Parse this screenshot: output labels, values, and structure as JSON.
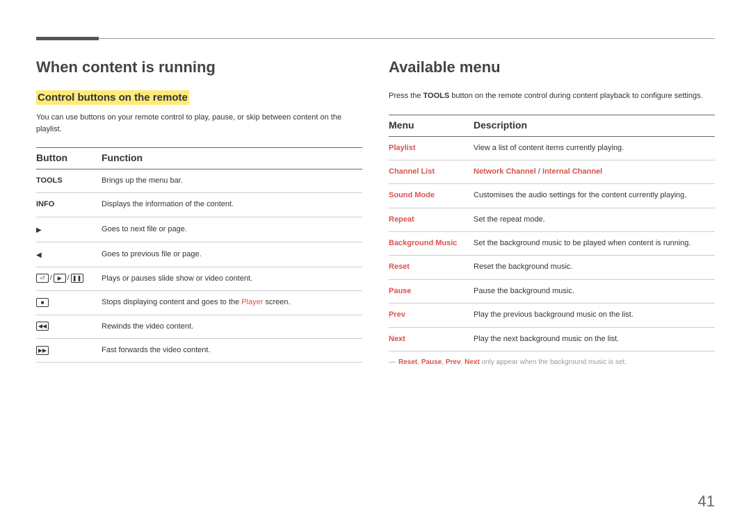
{
  "left": {
    "heading": "When content is running",
    "subheading": "Control buttons on the remote",
    "intro": "You can use buttons on your remote control to play, pause, or skip between content on the playlist.",
    "table": {
      "h1": "Button",
      "h2": "Function",
      "rows": [
        {
          "btn_type": "text",
          "btn": "TOOLS",
          "fn": "Brings up the menu bar."
        },
        {
          "btn_type": "text",
          "btn": "INFO",
          "fn": "Displays the information of the content."
        },
        {
          "btn_type": "arrow_right",
          "fn": "Goes to next file or page."
        },
        {
          "btn_type": "arrow_left",
          "fn": "Goes to previous file or page."
        },
        {
          "btn_type": "enter_play_pause",
          "fn": "Plays or pauses slide show or video content."
        },
        {
          "btn_type": "stop",
          "fn_pre": "Stops displaying content and goes to the ",
          "fn_red": "Player",
          "fn_post": " screen."
        },
        {
          "btn_type": "rewind",
          "fn": "Rewinds the video content."
        },
        {
          "btn_type": "ffwd",
          "fn": "Fast forwards the video content."
        }
      ]
    }
  },
  "right": {
    "heading": "Available menu",
    "intro_pre": "Press the ",
    "intro_bold": "TOOLS",
    "intro_post": " button on the remote control during content playback to configure settings.",
    "table": {
      "h1": "Menu",
      "h2": "Description",
      "rows": [
        {
          "menu": "Playlist",
          "desc": "View a list of content items currently playing."
        },
        {
          "menu": "Channel List",
          "desc_red1": "Network Channel",
          "desc_sep": " / ",
          "desc_red2": "Internal Channel"
        },
        {
          "menu": "Sound Mode",
          "desc": "Customises the audio settings for the content currently playing."
        },
        {
          "menu": "Repeat",
          "desc": "Set the repeat mode."
        },
        {
          "menu": "Background Music",
          "desc": "Set the background music to be played when content is running."
        },
        {
          "menu": "Reset",
          "desc": "Reset the background music."
        },
        {
          "menu": "Pause",
          "desc": "Pause the background music."
        },
        {
          "menu": "Prev",
          "desc": "Play the previous background music on the list."
        },
        {
          "menu": "Next",
          "desc": "Play the next background music on the list."
        }
      ]
    },
    "footnote": {
      "dash": "―",
      "r1": "Reset",
      "c1": ", ",
      "r2": "Pause",
      "c2": ", ",
      "r3": "Prev",
      "c3": ", ",
      "r4": "Next",
      "rest": " only appear when the background music is set."
    }
  },
  "page_number": "41"
}
